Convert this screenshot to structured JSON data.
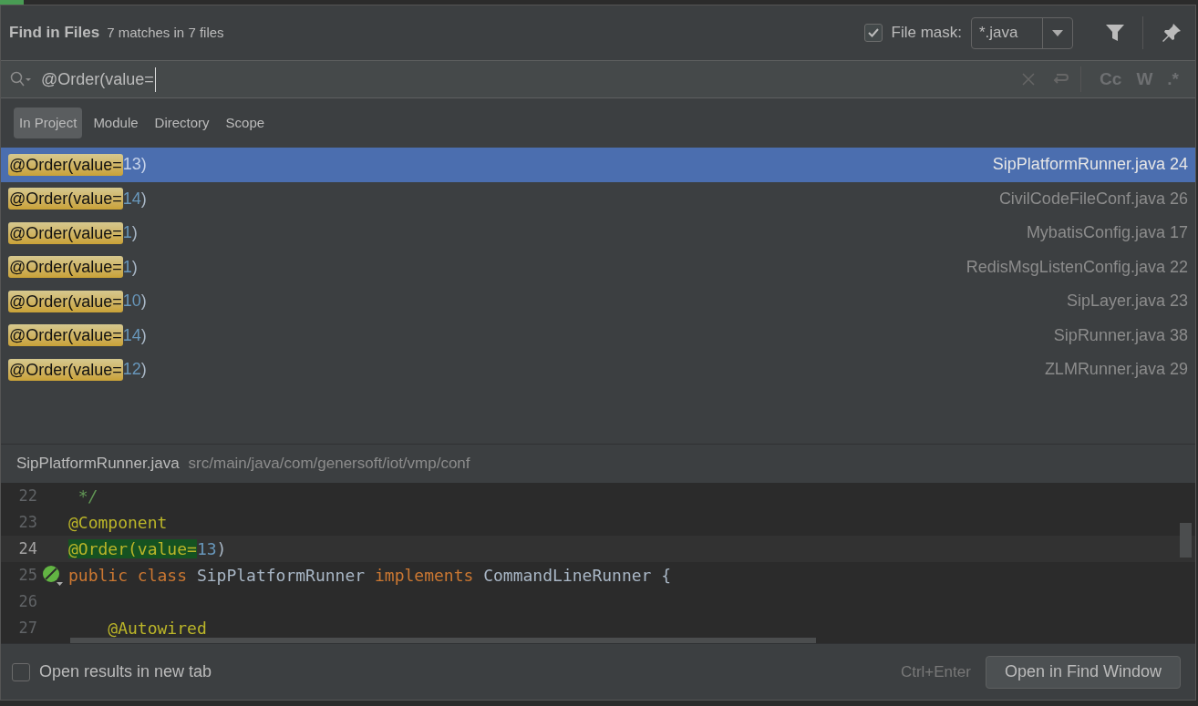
{
  "dialog": {
    "title": "Find in Files",
    "summary": "7 matches in 7 files",
    "file_mask": {
      "checked": true,
      "label": "File mask:",
      "value": "*.java"
    }
  },
  "search": {
    "value": "@Order(value=",
    "options": [
      "Cc",
      "W",
      ".*"
    ]
  },
  "scopes": [
    {
      "label": "In Project",
      "selected": true
    },
    {
      "label": "Module",
      "selected": false
    },
    {
      "label": "Directory",
      "selected": false
    },
    {
      "label": "Scope",
      "selected": false
    }
  ],
  "results": [
    {
      "match": "@Order(value=",
      "number": "13",
      "tail": ")",
      "file": "SipPlatformRunner.java",
      "line": "24",
      "selected": true
    },
    {
      "match": "@Order(value=",
      "number": "14",
      "tail": ")",
      "file": "CivilCodeFileConf.java",
      "line": "26",
      "selected": false
    },
    {
      "match": "@Order(value=",
      "number": "1",
      "tail": ")",
      "file": "MybatisConfig.java",
      "line": "17",
      "selected": false
    },
    {
      "match": "@Order(value=",
      "number": "1",
      "tail": ")",
      "file": "RedisMsgListenConfig.java",
      "line": "22",
      "selected": false
    },
    {
      "match": "@Order(value=",
      "number": "10",
      "tail": ")",
      "file": "SipLayer.java",
      "line": "23",
      "selected": false
    },
    {
      "match": "@Order(value=",
      "number": "14",
      "tail": ")",
      "file": "SipRunner.java",
      "line": "38",
      "selected": false
    },
    {
      "match": "@Order(value=",
      "number": "12",
      "tail": ")",
      "file": "ZLMRunner.java",
      "line": "29",
      "selected": false
    }
  ],
  "preview": {
    "file": "SipPlatformRunner.java",
    "path": "src/main/java/com/genersoft/iot/vmp/conf",
    "lines": [
      {
        "number": "22",
        "current": false,
        "run_marker": false,
        "tokens": [
          {
            "kind": "comment",
            "text": " */"
          }
        ]
      },
      {
        "number": "23",
        "current": false,
        "run_marker": false,
        "tokens": [
          {
            "kind": "annotation",
            "text": "@Component"
          }
        ]
      },
      {
        "number": "24",
        "current": true,
        "run_marker": false,
        "tokens": [
          {
            "kind": "match",
            "text": "@Order(value="
          },
          {
            "kind": "number",
            "text": "13"
          },
          {
            "kind": "plain",
            "text": ")"
          }
        ]
      },
      {
        "number": "25",
        "current": false,
        "run_marker": true,
        "tokens": [
          {
            "kind": "keyword",
            "text": "public class "
          },
          {
            "kind": "plain",
            "text": "SipPlatformRunner "
          },
          {
            "kind": "keyword",
            "text": "implements "
          },
          {
            "kind": "plain",
            "text": "CommandLineRunner {"
          }
        ]
      },
      {
        "number": "26",
        "current": false,
        "run_marker": false
      },
      {
        "number": "27",
        "current": false,
        "run_marker": false,
        "tokens": [
          {
            "kind": "annotation",
            "text": "    @Autowired"
          }
        ]
      }
    ]
  },
  "footer": {
    "new_tab": {
      "checked": false,
      "label": "Open results in new tab"
    },
    "shortcut": "Ctrl+Enter",
    "button": "Open in Find Window"
  }
}
